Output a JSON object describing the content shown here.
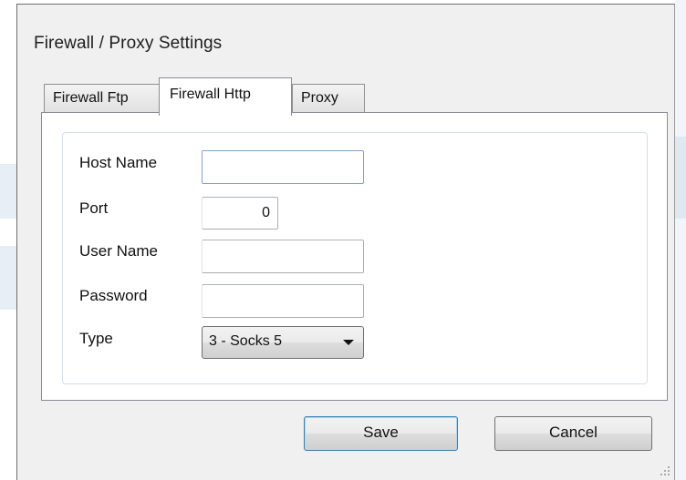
{
  "window": {
    "title": "Firewall / Proxy Settings"
  },
  "tabs": [
    {
      "label": "Firewall Ftp",
      "active": false
    },
    {
      "label": "Firewall Http",
      "active": true
    },
    {
      "label": "Proxy",
      "active": false
    }
  ],
  "form": {
    "host_name": {
      "label": "Host Name",
      "value": ""
    },
    "port": {
      "label": "Port",
      "value": "0"
    },
    "user_name": {
      "label": "User Name",
      "value": ""
    },
    "password": {
      "label": "Password",
      "value": ""
    },
    "type": {
      "label": "Type",
      "selected": "3 - Socks 5"
    }
  },
  "buttons": {
    "save_label": "Save",
    "cancel_label": "Cancel"
  },
  "colors": {
    "dialog_bg": "#f0f0f0",
    "panel_bg": "#ffffff",
    "focus_border": "#7da2ce",
    "default_button_border": "#3c7fb1"
  },
  "icons": {
    "combo_arrow": "chevron-down-icon",
    "resize_grip": "size-grip-icon"
  }
}
